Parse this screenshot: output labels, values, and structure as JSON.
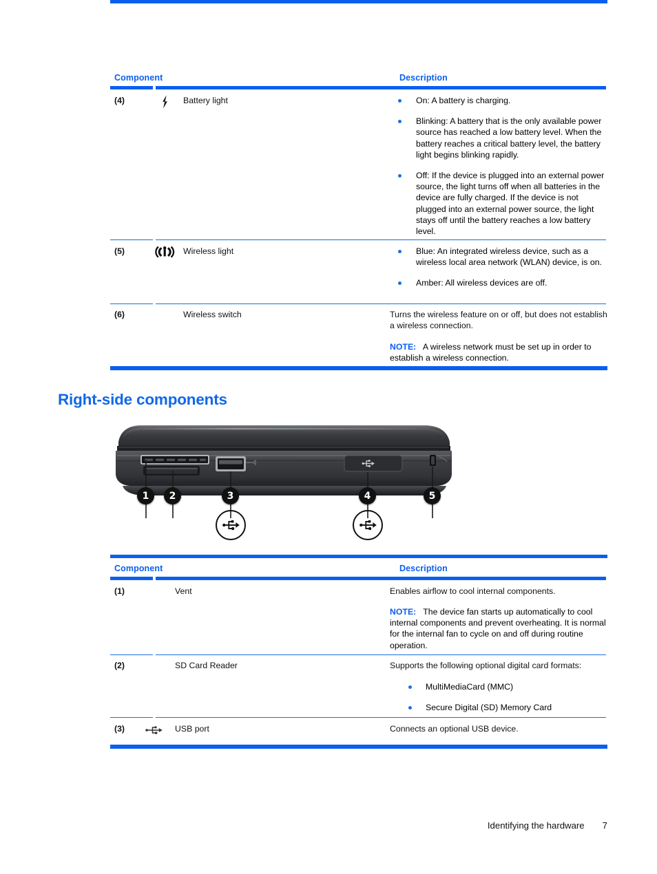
{
  "document": {
    "footer": {
      "chapter": "Identifying the hardware",
      "page_number": "7"
    }
  },
  "table_top": {
    "headers": {
      "component": "Component",
      "description": "Description"
    },
    "rows": [
      {
        "number": "(4)",
        "icon": "battery-lightning-icon",
        "name": "Battery light",
        "bullets": [
          "On: A battery is charging.",
          "Blinking: A battery that is the only available power source has reached a low battery level. When the battery reaches a critical battery level, the battery light begins blinking rapidly.",
          "Off: If the device is plugged into an external power source, the light turns off when all batteries in the device are fully charged. If the device is not plugged into an external power source, the light stays off until the battery reaches a low battery level."
        ]
      },
      {
        "number": "(5)",
        "icon": "wireless-antenna-icon",
        "name": "Wireless light",
        "bullets": [
          "Blue: An integrated wireless device, such as a wireless local area network (WLAN) device, is on.",
          "Amber: All wireless devices are off."
        ]
      },
      {
        "number": "(6)",
        "icon": "",
        "name": "Wireless switch",
        "description": "Turns the wireless feature on or off, but does not establish a wireless connection.",
        "note_label": "NOTE:",
        "note_text": "A wireless network must be set up in order to establish a wireless connection."
      }
    ]
  },
  "section": {
    "heading": "Right-side components",
    "illustration": {
      "name": "laptop-right-side-view",
      "callouts": [
        "1",
        "2",
        "3",
        "4",
        "5"
      ],
      "usb_symbols": 2
    }
  },
  "table_bottom": {
    "headers": {
      "component": "Component",
      "description": "Description"
    },
    "rows": [
      {
        "number": "(1)",
        "icon": "",
        "name": "Vent",
        "description": "Enables airflow to cool internal components.",
        "note_label": "NOTE:",
        "note_text": "The device fan starts up automatically to cool internal components and prevent overheating. It is normal for the internal fan to cycle on and off during routine operation."
      },
      {
        "number": "(2)",
        "icon": "",
        "name": "SD Card Reader",
        "description": "Supports the following optional digital card formats:",
        "bullets": [
          "MultiMediaCard (MMC)",
          "Secure Digital (SD) Memory Card"
        ]
      },
      {
        "number": "(3)",
        "icon": "usb-icon",
        "name": "USB port",
        "description": "Connects an optional USB device."
      }
    ]
  },
  "colors": {
    "rule_blue": "#0a5ff0",
    "heading_blue": "#1168e8",
    "bullet_blue": "#1a6fe0",
    "text_black": "#111111"
  }
}
